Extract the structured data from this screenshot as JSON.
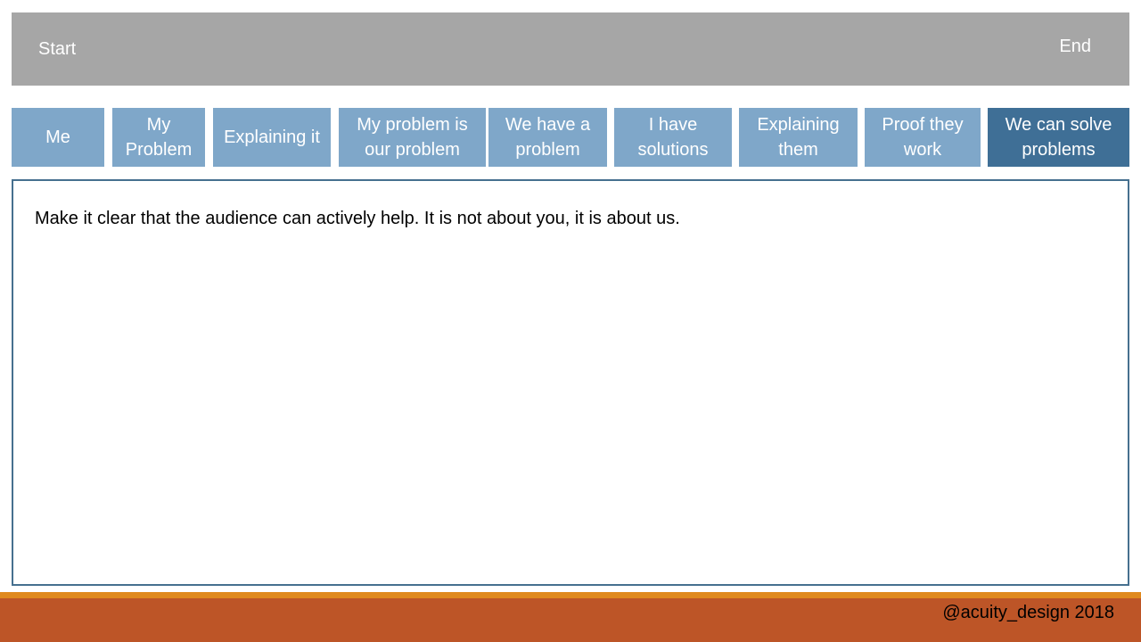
{
  "timeline": {
    "start_label": "Start",
    "end_label": "End"
  },
  "steps": [
    {
      "label": "Me",
      "active": false
    },
    {
      "label": "My Problem",
      "active": false
    },
    {
      "label": "Explaining it",
      "active": false
    },
    {
      "label": "My problem is our problem",
      "active": false
    },
    {
      "label": "We have a problem",
      "active": false
    },
    {
      "label": "I have solutions",
      "active": false
    },
    {
      "label": "Explaining them",
      "active": false
    },
    {
      "label": "Proof they work",
      "active": false
    },
    {
      "label": "We can solve problems",
      "active": true
    }
  ],
  "content": {
    "text": "Make it clear that the audience can actively help. It is not about you, it is about us."
  },
  "footer": {
    "credit": "@acuity_design 2018"
  },
  "colors": {
    "timeline_bar": "#a6a6a6",
    "step": "#7fa7c9",
    "step_active": "#3f6f96",
    "content_border": "#46708f",
    "footer_accent": "#e08a1e",
    "footer": "#bd5527"
  }
}
